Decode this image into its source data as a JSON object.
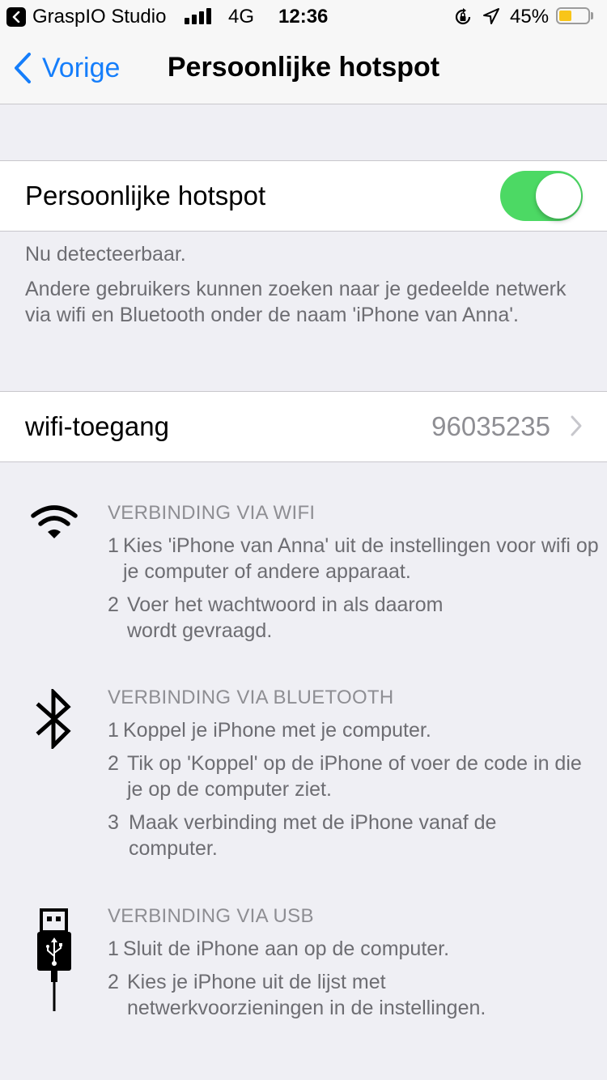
{
  "status_bar": {
    "carrier": "GraspIO Studio",
    "network": "4G",
    "time": "12:36",
    "battery_percent_label": "45%",
    "battery_level": 0.45,
    "battery_color": "#f8c519",
    "icons": [
      "back-to-app-icon",
      "signal-icon",
      "orientation-lock-icon",
      "location-icon",
      "battery-icon"
    ]
  },
  "nav": {
    "back_label": "Vorige",
    "title": "Persoonlijke hotspot",
    "accent": "#157efb"
  },
  "hotspot": {
    "label": "Persoonlijke hotspot",
    "toggle_on": true,
    "toggle_color": "#4cd964"
  },
  "info": {
    "discoverable": "Nu detecteerbaar.",
    "description": "Andere gebruikers kunnen zoeken naar je gedeelde netwerk via wifi en Bluetooth onder de naam 'iPhone van Anna'."
  },
  "wifi_access": {
    "label": "wifi-toegang",
    "value": "96035235"
  },
  "sections": {
    "wifi": {
      "icon": "wifi-icon",
      "heading": "VERBINDING VIA WIFI",
      "steps": [
        {
          "num": "1",
          "text": "Kies 'iPhone van Anna' uit de instellingen voor wifi op je computer of andere apparaat."
        },
        {
          "num": "2",
          "text": "Voer het wachtwoord in als daarom wordt gevraagd."
        }
      ]
    },
    "bluetooth": {
      "icon": "bluetooth-icon",
      "heading": "VERBINDING VIA BLUETOOTH",
      "steps": [
        {
          "num": "1",
          "text": "Koppel je iPhone met je computer."
        },
        {
          "num": "2",
          "text": "Tik op 'Koppel' op de iPhone of voer de code in die je op de computer ziet."
        },
        {
          "num": "3",
          "text": "Maak verbinding met de iPhone vanaf de computer."
        }
      ]
    },
    "usb": {
      "icon": "usb-icon",
      "heading": "VERBINDING VIA USB",
      "steps": [
        {
          "num": "1",
          "text": "Sluit de iPhone aan op de computer."
        },
        {
          "num": "2",
          "text": "Kies je iPhone uit de lijst met netwerkvoorzieningen in de instellingen."
        }
      ]
    }
  }
}
